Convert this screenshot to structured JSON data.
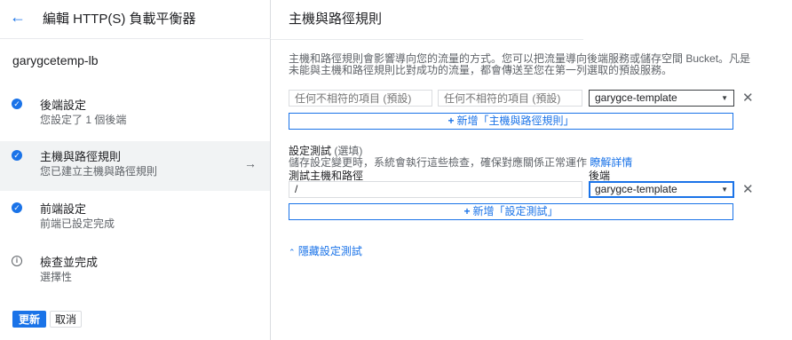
{
  "left": {
    "title": "編輯 HTTP(S) 負載平衡器",
    "lb_name": "garygcetemp-lb",
    "steps": [
      {
        "title": "後端設定",
        "sub": "您設定了 1 個後端",
        "status": "done"
      },
      {
        "title": "主機與路徑規則",
        "sub": "您已建立主機與路徑規則",
        "status": "done",
        "active": true
      },
      {
        "title": "前端設定",
        "sub": "前端已設定完成",
        "status": "done"
      },
      {
        "title": "檢查並完成",
        "sub": "選擇性",
        "status": "info"
      }
    ],
    "update_label": "更新",
    "cancel_label": "取消"
  },
  "right": {
    "title": "主機與路徑規則",
    "description": "主機和路徑規則會影響導向您的流量的方式。您可以把流量導向後端服務或儲存空間 Bucket。凡是未能與主機和路徑規則比對成功的流量，都會傳送至您在第一列選取的預設服務。",
    "rule_row": {
      "host_placeholder": "任何不相符的項目 (預設)",
      "path_placeholder": "任何不相符的項目 (預設)",
      "backend": "garygce-template"
    },
    "add_rule_label": "新增「主機與路徑規則」",
    "test_section": {
      "title": "設定測試",
      "optional": "(選填)",
      "subtitle": "儲存設定變更時，系統會執行這些檢查，確保對應關係正常運作",
      "learn_more": "瞭解詳情",
      "host_path_label": "測試主機和路徑",
      "backend_label": "後端",
      "host_path_value": "/",
      "backend": "garygce-template",
      "add_test_label": "新增「設定測試」",
      "hide_label": "隱藏設定測試"
    }
  },
  "colors": {
    "accent": "#1a73e8",
    "text": "#202124",
    "muted": "#5f6368"
  }
}
